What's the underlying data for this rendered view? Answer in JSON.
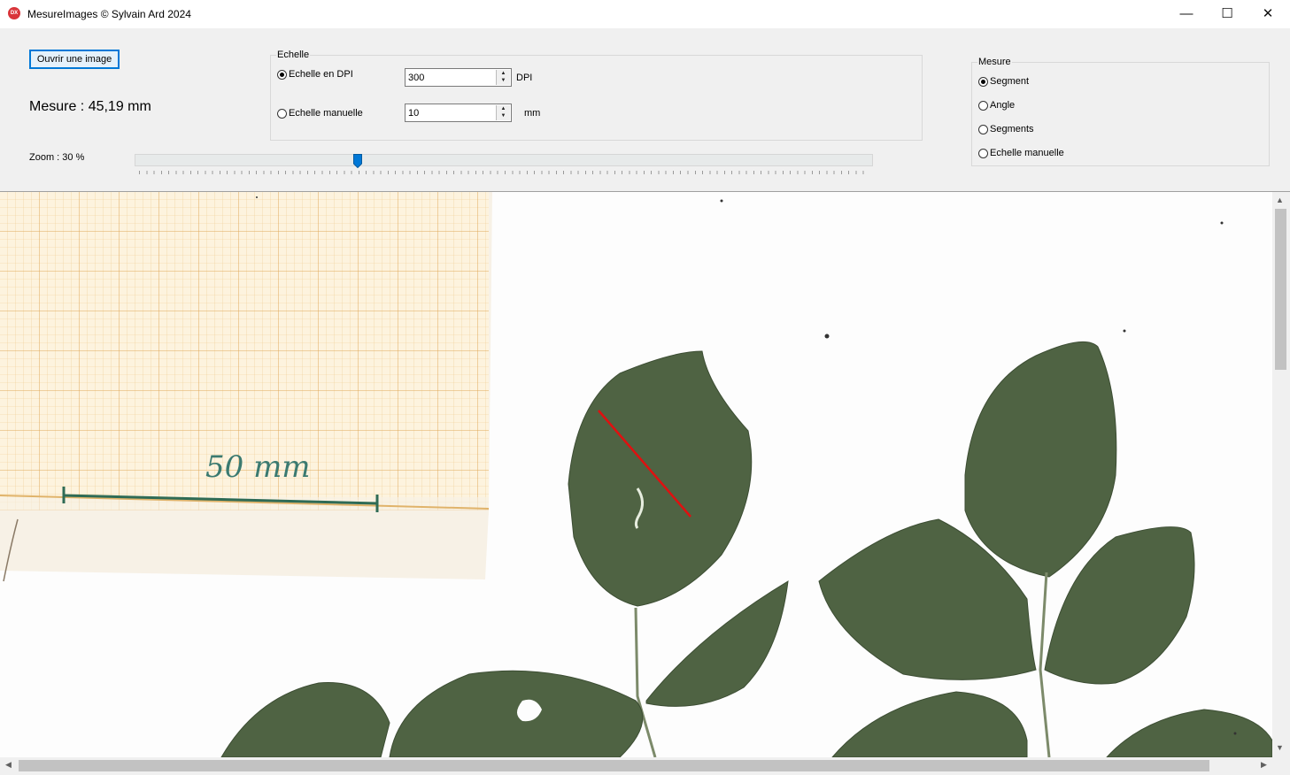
{
  "window": {
    "title": "MesureImages © Sylvain Ard 2024",
    "icon_label": "DX",
    "minimize_glyph": "—",
    "maximize_glyph": "☐",
    "close_glyph": "✕"
  },
  "toolbar": {
    "open_image_label": "Ouvrir une image",
    "measure_text": "Mesure : 45,19 mm",
    "zoom_label": "Zoom : 30 %",
    "zoom_value_percent": 30
  },
  "echelle": {
    "legend": "Echelle",
    "dpi_radio_label": "Echelle en DPI",
    "dpi_selected": true,
    "dpi_value": "300",
    "dpi_unit": "DPI",
    "manual_radio_label": "Echelle manuelle",
    "manual_selected": false,
    "manual_value": "10",
    "manual_unit": "mm"
  },
  "mesure_group": {
    "legend": "Mesure",
    "options": [
      {
        "label": "Segment",
        "selected": true
      },
      {
        "label": "Angle",
        "selected": false
      },
      {
        "label": "Segments",
        "selected": false
      },
      {
        "label": "Echelle manuelle",
        "selected": false
      }
    ]
  },
  "scan": {
    "handwritten_label": "50 mm"
  },
  "colors": {
    "accent": "#0078d7",
    "measure_line": "#e01010",
    "leaf": "#4f6343",
    "grid_paper": "#e6b465"
  }
}
